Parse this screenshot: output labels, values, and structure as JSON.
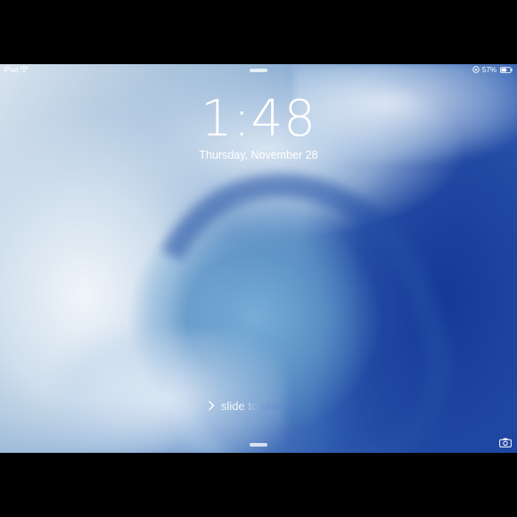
{
  "status_bar": {
    "device": "iPad",
    "wifi_icon": "wifi-icon",
    "orientation_icon": "orientation-lock-icon",
    "battery_percent": "57%",
    "battery_icon": "battery-icon",
    "battery_level": 0.57
  },
  "lock_screen": {
    "time": "1:48",
    "date": "Thursday, November 28",
    "slide_label": "slide to unlock",
    "slide_icon": "chevron-right-icon",
    "camera_icon": "camera-icon",
    "grabber_top_icon": "notification-center-grabber",
    "grabber_bottom_icon": "control-center-grabber"
  },
  "colors": {
    "frame": "#000000",
    "text": "#ffffff",
    "wave_deep": "#1c46a2",
    "wave_light": "#9fbcd8"
  }
}
